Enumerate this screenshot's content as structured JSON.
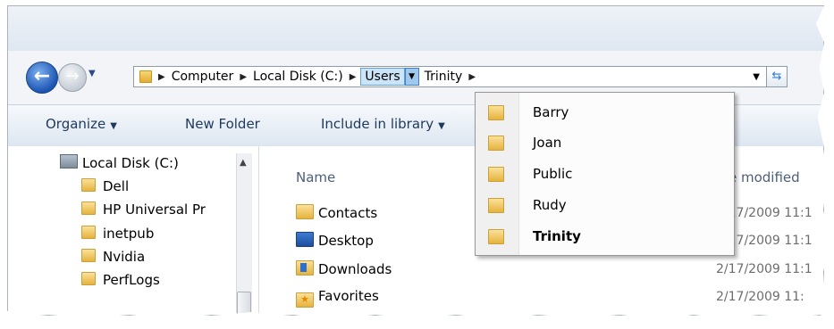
{
  "window": {
    "background": "#f2f4f7"
  },
  "nav": {
    "back_icon": "back-arrow-icon",
    "forward_icon": "forward-arrow-icon",
    "history_icon": "chevron-down-icon"
  },
  "address_bar": {
    "crumbs": [
      "Computer",
      "Local Disk (C:)",
      "Users",
      "Trinity"
    ],
    "selected_crumb": "Users",
    "refresh_icon": "refresh-icon"
  },
  "toolbar": {
    "organize": "Organize",
    "new_folder": "New Folder",
    "include_in_library": "Include in library"
  },
  "nav_pane": {
    "items": [
      "Local Disk (C:)",
      "Dell",
      "HP Universal Pr",
      "inetpub",
      "Nvidia",
      "PerfLogs"
    ]
  },
  "content": {
    "columns": {
      "name": "Name",
      "date": "e modified"
    },
    "files": [
      {
        "name": "Contacts",
        "date": "2/17/2009 11:1",
        "icon": "contacts-folder-icon"
      },
      {
        "name": "Desktop",
        "date": "2/17/2009 11:1",
        "icon": "desktop-folder-icon"
      },
      {
        "name": "Downloads",
        "date": "2/17/2009 11:1",
        "icon": "downloads-folder-icon"
      },
      {
        "name": "Favorites",
        "date": "2/17/2009 11:",
        "icon": "favorites-folder-icon"
      }
    ]
  },
  "dropdown": {
    "items": [
      {
        "label": "Barry",
        "bold": false
      },
      {
        "label": "Joan",
        "bold": false
      },
      {
        "label": "Public",
        "bold": false
      },
      {
        "label": "Rudy",
        "bold": false
      },
      {
        "label": "Trinity",
        "bold": true
      }
    ]
  }
}
